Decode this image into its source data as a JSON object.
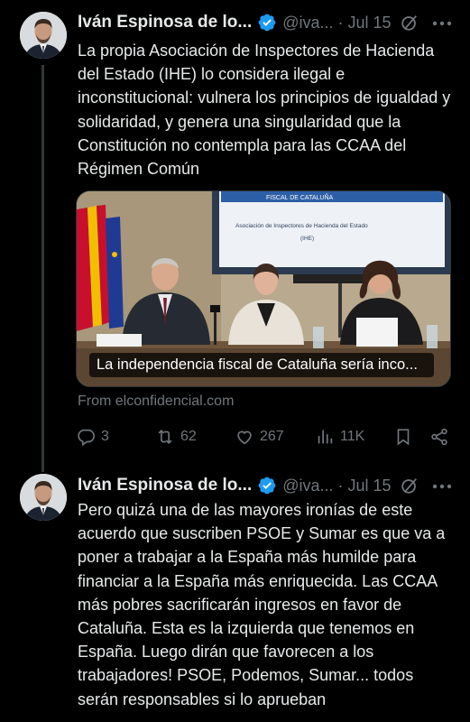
{
  "tweets": [
    {
      "author_name": "Iván Espinosa de lo...",
      "handle": "@iva...",
      "dot": "·",
      "date": "Jul 15",
      "text": "La propia Asociación de Inspectores de Hacienda del Estado (IHE) lo considera ilegal e inconstitucional: vulnera los principios de igualdad y solidaridad, y genera una singularidad que la Constitución no contempla para las CCAA del Régimen Común",
      "link_card": {
        "caption": "La independencia fiscal de Cataluña sería inco...",
        "screen_title": "FISCAL DE CATALUÑA",
        "screen_subtitle": "Asociación de Inspectores de Hacienda del Estado",
        "screen_acronym": "(IHE)",
        "source": "From elconfidencial.com"
      },
      "metrics": {
        "replies": "3",
        "reposts": "62",
        "likes": "267",
        "views": "11K"
      }
    },
    {
      "author_name": "Iván Espinosa de lo...",
      "handle": "@iva...",
      "dot": "·",
      "date": "Jul 15",
      "text": "Pero quizá una de las mayores ironías de este acuerdo que suscriben PSOE y Sumar es que va a poner a trabajar a la España más humilde para financiar a la España más enriquecida. Las CCAA más pobres sacrificarán ingresos en favor de Cataluña. Esta es la izquierda que tenemos en España. Luego dirán que favorecen a los trabajadores! PSOE, Podemos, Sumar... todos serán responsables si lo aprueban"
    }
  ],
  "colors": {
    "background": "#000000",
    "text": "#e7e9ea",
    "muted": "#71767b",
    "verified": "#1d9bf0",
    "divider": "#2f3336"
  },
  "icons": [
    "verified-badge-icon",
    "grok-icon",
    "more-icon",
    "reply-icon",
    "repost-icon",
    "like-icon",
    "views-icon",
    "bookmark-icon",
    "share-icon"
  ]
}
